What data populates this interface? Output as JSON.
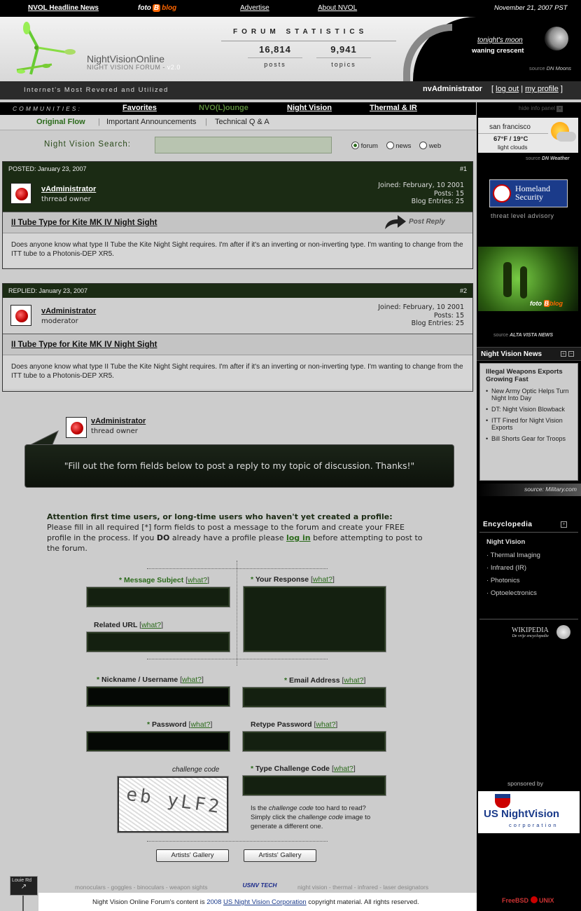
{
  "topbar": {
    "headline": "NVOL Headline News",
    "foto": "foto",
    "blog": "blog",
    "advertise": "Advertise",
    "about": "About NVOL",
    "date": "November 21, 2007",
    "tz": "PST"
  },
  "header": {
    "site_name": "NightVisionOnline",
    "site_sub": "NIGHT VISION FORUM -",
    "version": "v2.0",
    "stats_title": "FORUM STATISTICS",
    "posts_num": "16,814",
    "posts_label": "posts",
    "topics_num": "9,941",
    "topics_label": "topics",
    "moon_title": "tonight's moon",
    "moon_phase": "waning crescent",
    "moon_source_prefix": "source",
    "moon_source": "DN Moons"
  },
  "subbar": {
    "tagline": "Internet's Most Revered and Utilized",
    "user": "nvAdministrator",
    "logout": "log out",
    "profile": "my profile"
  },
  "communities": {
    "label": "COMMUNITIES:",
    "items": [
      "Favorites",
      "NVO(L)ounge",
      "Night Vision",
      "Thermal & IR"
    ]
  },
  "subtabs": [
    "Original Flow",
    "Important Announcements",
    "Technical Q & A"
  ],
  "search": {
    "label": "Night Vision Search:",
    "options": [
      "forum",
      "news",
      "web"
    ],
    "selected": "forum"
  },
  "posts": [
    {
      "header": "POSTED: January 23, 2007",
      "num": "#1",
      "user": "vAdministrator",
      "role": "thrread owner",
      "joined": "Joined: February, 10 2001",
      "posts": "Posts: 15",
      "blog": "Blog Entries: 25",
      "title": "II Tube Type for Kite MK IV Night Sight",
      "reply": "Post Reply",
      "body": "Does anyone know what type II Tube the Kite Night Sight requires. I'm after if it's an inverting or non-inverting type. I'm wanting to change from the ITT tube to a Photonis-DEP XR5."
    },
    {
      "header": "REPLIED: January 23, 2007",
      "num": "#2",
      "user": "vAdministrator",
      "role": "moderator",
      "joined": "Joined: February, 10 2001",
      "posts": "Posts: 15",
      "blog": "Blog Entries: 25",
      "title": "II Tube Type for Kite MK IV Night Sight",
      "body": "Does anyone know what type II Tube the Kite Night Sight requires. I'm after if it's an inverting or non-inverting type. I'm wanting to change from the ITT tube to a Photonis-DEP XR5."
    }
  ],
  "bubble": {
    "user": "vAdministrator",
    "role": "thread owner",
    "text": "\"Fill out the form fields below to post a reply to my topic of discussion. Thanks!\""
  },
  "intro": {
    "heading": "Attention first time users, or long-time users who haven't yet created a profile:",
    "text1": "Please fill in all required [*] form fields to post a message to the forum and create your FREE profile in the process. If you",
    "do": "DO",
    "text2": "already have a profile please",
    "login": "log in",
    "text3": "before attempting to post to the forum."
  },
  "form": {
    "what": "what?",
    "subject": "Message Subject",
    "response": "Your Response",
    "related": "Related URL",
    "nickname": "Nickname / Username",
    "email": "Email Address",
    "password": "Password",
    "retype": "Retype Password",
    "challenge_caption": "challenge code",
    "challenge_label": "Type Challenge Code",
    "captcha_text": "eb yLF2",
    "help_1": "Is the",
    "help_italic1": "challenge code",
    "help_2": "too hard to read? Simply click the",
    "help_italic2": "challenge code",
    "help_3": "image to generate a different one.",
    "button1": "Artists' Gallery",
    "button2": "Artists' Gallery"
  },
  "footer": {
    "sign": "Louie Rd",
    "left_links": "monoculars - goggles - binoculars - weapon sights",
    "logo": "USNV TECH",
    "right_links": "night vision - thermal - infrared - laser designators",
    "copy_pre": "Night Vision Online Forum's content is",
    "copy_year": "2008",
    "copy_link": "US Night Vision Corporation",
    "copy_post": "copyright material. All rights reserved."
  },
  "sidebar": {
    "hide": "hide info panel",
    "city": "san francisco",
    "temp": "67°F / 19°C",
    "cond": "light clouds",
    "weather_src_prefix": "source",
    "weather_src": "DN Weather",
    "hs_title": "Homeland",
    "hs_title2": "Security",
    "hs_caption": "threat level advisory",
    "foto": "foto",
    "blog": "blog",
    "photo_src_prefix": "source",
    "photo_src": "ALTA VISTA NEWS",
    "news_title": "Night Vision News",
    "news_head": "Illegal Weapons Exports Growing Fast",
    "news": [
      "New Army Optic Helps Turn Night Into Day",
      "DT: Night Vision Blowback",
      "ITT Fined for Night Vision Exports",
      "Bill Shorts Gear for Troops"
    ],
    "news_src_prefix": "source:",
    "news_src": "Military.com",
    "enc_title": "Encyclopedia",
    "enc_head": "Night Vision",
    "enc": [
      "Thermal Imaging",
      "Infrared (IR)",
      "Photonics",
      "Optoelectronics"
    ],
    "wiki": "WIKIPEDIA",
    "wiki_sub": "De vrije encyclopedie",
    "sponsor": "sponsored by",
    "sponsor_name": "US NightVision",
    "sponsor_sub": "corporation",
    "freebsd": "FreeBSD",
    "unix": "UNIX"
  },
  "colors": {
    "accent_green": "#2a6a1a",
    "dark_green": "#1b2b14",
    "field": "#142010"
  }
}
